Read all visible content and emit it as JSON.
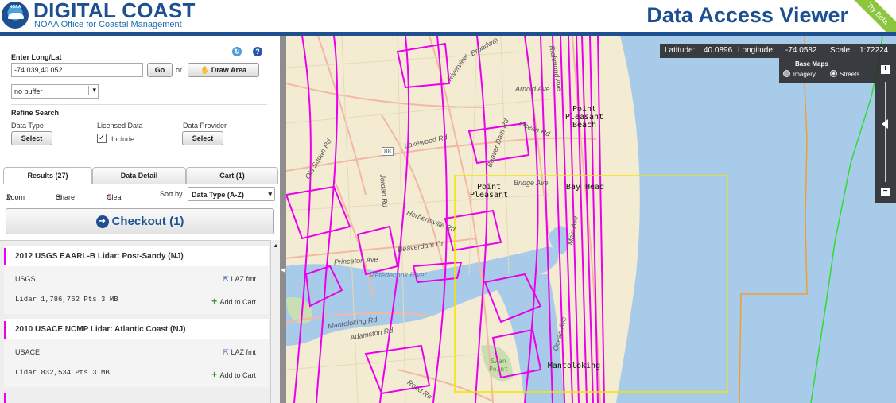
{
  "header": {
    "logo_text": "NOAA",
    "brand_title": "DIGITAL COAST",
    "brand_subtitle": "NOAA Office for Coastal Management",
    "app_title": "Data Access Viewer",
    "beta_label": "Try Beta"
  },
  "search": {
    "label": "Enter Long/Lat",
    "value": "-74.039,40.052",
    "go_label": "Go",
    "or_label": "or",
    "draw_area_label": "Draw Area",
    "buffer_value": "no buffer"
  },
  "refine": {
    "title": "Refine Search",
    "data_type_label": "Data Type",
    "data_type_button": "Select",
    "licensed_label": "Licensed Data",
    "include_label": "Include",
    "include_checked": true,
    "provider_label": "Data Provider",
    "provider_button": "Select"
  },
  "tabs": [
    {
      "label": "Results (27)",
      "active": true
    },
    {
      "label": "Data Detail",
      "active": false
    },
    {
      "label": "Cart (1)",
      "active": false
    }
  ],
  "toolbar": {
    "zoom": "Zoom",
    "share": "Share",
    "clear": "Clear",
    "sort_label": "Sort by",
    "sort_value": "Data Type (A-Z)"
  },
  "checkout": {
    "label": "Checkout (1)"
  },
  "results": [
    {
      "title": "2012 USGS EAARL-B Lidar: Post-Sandy (NJ)",
      "provider": "USGS",
      "format": "LAZ fmt",
      "meta": "Lidar  1,786,762 Pts  3 MB",
      "add": "Add to Cart"
    },
    {
      "title": "2010 USACE NCMP Lidar: Atlantic Coast (NJ)",
      "provider": "USACE",
      "format": "LAZ fmt",
      "meta": "Lidar  832,534 Pts  3 MB",
      "add": "Add to Cart"
    }
  ],
  "map": {
    "latitude_label": "Latitude:",
    "latitude_value": "40.0896",
    "longitude_label": "Longitude:",
    "longitude_value": "-74.0582",
    "scale_label": "Scale:",
    "scale_value": "1:72224",
    "basemaps_title": "Base Maps",
    "basemap_imagery": "Imagery",
    "basemap_streets": "Streets",
    "selected_basemap": "Streets",
    "roads": [
      "Broadway",
      "Riverview",
      "Arnold Ave",
      "Ocean Rd",
      "Old Squan Rd",
      "Lakewood Rd",
      "Jordan Rd",
      "Herbertsville Rd",
      "Bridge Ave",
      "Beaverdam Cr",
      "Princeton Ave",
      "Metedeconk River",
      "Mantoloking Rd",
      "Adamston Rd",
      "Ocean Ave",
      "Reed Rd",
      "Main Ave",
      "Richmond Ave",
      "Beaver Dam Rd"
    ],
    "places": [
      "Point Pleasant Beach",
      "Point Pleasant",
      "Bay Head",
      "Mantoloking",
      "Swan Point"
    ],
    "route_labels": [
      "88"
    ],
    "colors": {
      "land": "#f3ecd2",
      "water": "#a8cbea",
      "footprints": "#ea00ea",
      "selection": "#f2e600",
      "boundary_orange": "#f39c32",
      "boundary_green": "#2fdc2f"
    }
  }
}
